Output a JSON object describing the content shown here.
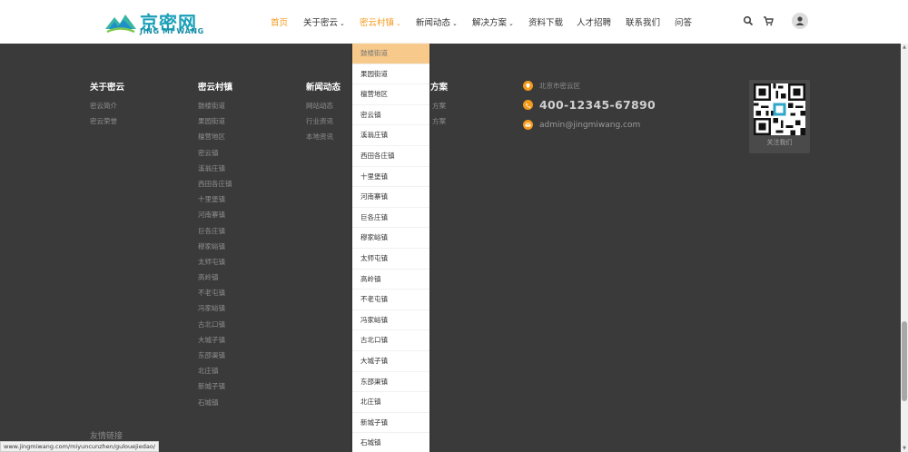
{
  "logo": {
    "cn": "京密网",
    "en": "JING MI WANG"
  },
  "nav": {
    "items": [
      {
        "label": "首页",
        "chevron": false
      },
      {
        "label": "关于密云",
        "chevron": true
      },
      {
        "label": "密云村镇",
        "chevron": true
      },
      {
        "label": "新闻动态",
        "chevron": true
      },
      {
        "label": "解决方案",
        "chevron": true
      },
      {
        "label": "资料下载",
        "chevron": false
      },
      {
        "label": "人才招聘",
        "chevron": false
      },
      {
        "label": "联系我们",
        "chevron": false
      },
      {
        "label": "问答",
        "chevron": false
      }
    ],
    "active_index": 0,
    "hovered_index": 2,
    "chevron_glyph": "⌄",
    "icons": [
      "search-icon",
      "cart-icon",
      "user-avatar-icon"
    ],
    "accent_color": "#f39a1b"
  },
  "footer": {
    "columns": [
      {
        "title": "关于密云",
        "items": [
          "密云简介",
          "密云荣誉"
        ]
      },
      {
        "title": "密云村镇",
        "items": [
          "鼓楼街道",
          "果园街道",
          "檀营地区",
          "密云镇",
          "溪翁庄镇",
          "西田各庄镇",
          "十里堡镇",
          "河南寨镇",
          "巨各庄镇",
          "穆家峪镇",
          "太师屯镇",
          "高岭镇",
          "不老屯镇",
          "冯家峪镇",
          "古北口镇",
          "大城子镇",
          "东邵渠镇",
          "北庄镇",
          "新城子镇",
          "石城镇"
        ]
      },
      {
        "title": "新闻动态",
        "items": [
          "网站动态",
          "行业资讯",
          "本地资讯"
        ]
      },
      {
        "title": "方案",
        "items": [
          "方案",
          "方案"
        ]
      }
    ],
    "contact": {
      "address": "北京市密云区",
      "phone": "400-12345-67890",
      "email": "admin@jingmiwang.com",
      "icons": [
        "location-pin-icon",
        "phone-icon",
        "email-icon"
      ]
    },
    "qr": {
      "label": "关注我们"
    },
    "friend_links_title": "友情链接",
    "background_color": "#3a3a3a"
  },
  "dropdown": {
    "items": [
      "鼓楼街道",
      "果园街道",
      "檀营地区",
      "密云镇",
      "溪翁庄镇",
      "西田各庄镇",
      "十里堡镇",
      "河南寨镇",
      "巨各庄镇",
      "穆家峪镇",
      "太师屯镇",
      "高岭镇",
      "不老屯镇",
      "冯家峪镇",
      "古北口镇",
      "大城子镇",
      "东邵渠镇",
      "北庄镇",
      "新城子镇",
      "石城镇"
    ],
    "highlighted_index": 0,
    "highlight_color": "#f7c98a"
  },
  "status_bar": {
    "url": "www.jingmiwang.com/miyuncunzhen/gulouejiedao/"
  }
}
